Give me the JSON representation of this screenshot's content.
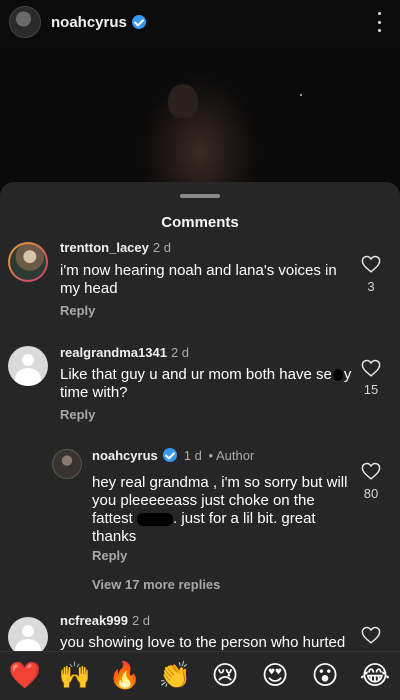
{
  "header": {
    "username": "noahcyrus"
  },
  "sheet": {
    "title": "Comments"
  },
  "comments": [
    {
      "username": "trentton_lacey",
      "time": "2 d",
      "text_lines": [
        "i'm now hearing noah and lana's voices in",
        "my head"
      ],
      "reply_label": "Reply",
      "likes": "3"
    },
    {
      "username": "realgrandma1341",
      "time": "2 d",
      "text_line1_a": "Like that guy u and ur mom both have se",
      "text_line1_b": "y",
      "text_line2": "time with?",
      "reply_label": "Reply",
      "likes": "15"
    },
    {
      "username": "noahcyrus",
      "time": "1 d",
      "separator": "•",
      "author_label": "Author",
      "text_line1": "hey real grandma , i'm so sorry but will",
      "text_line2": "you pleeeeeass just choke on the",
      "text_line3_a": "fattest",
      "text_line3_b": ". just for a lil bit.  great",
      "text_line4": "thanks",
      "reply_label": "Reply",
      "likes": "80"
    },
    {
      "username": "ncfreak999",
      "time": "2 d",
      "text_line1": "you showing love to the person who hurted"
    }
  ],
  "view_more": "View 17 more replies",
  "reactions": [
    {
      "emoji": "❤️",
      "name": "red-heart"
    },
    {
      "emoji": "🙌",
      "name": "raising-hands"
    },
    {
      "emoji": "🔥",
      "name": "fire"
    },
    {
      "emoji": "👏",
      "name": "clapping-hands"
    },
    {
      "emoji": "😢",
      "name": "crying-face"
    },
    {
      "emoji": "😍",
      "name": "heart-eyes"
    },
    {
      "emoji": "😮",
      "name": "open-mouth"
    },
    {
      "emoji": "😂",
      "name": "tears-of-joy"
    }
  ],
  "colors": {
    "sheet_bg": "#262626",
    "verified": "#3897f0",
    "muted_text": "#a8a8a8"
  }
}
